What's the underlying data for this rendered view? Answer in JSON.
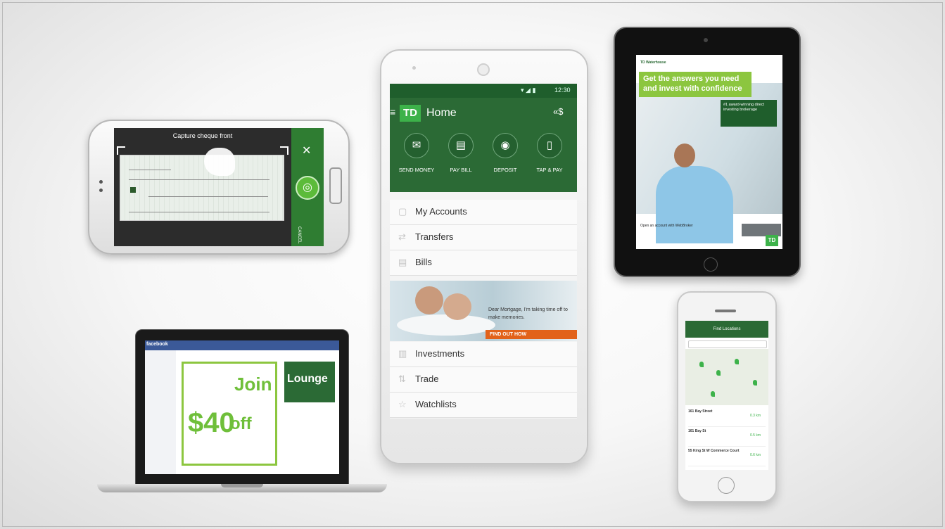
{
  "landscape_phone": {
    "capture_title": "Capture cheque front",
    "cancel_label": "CANCEL"
  },
  "center_phone": {
    "status_time": "12:30",
    "app_logo": "TD",
    "title": "Home",
    "actions": [
      {
        "label": "SEND MONEY",
        "icon": "send-money-icon",
        "glyph": "✉"
      },
      {
        "label": "PAY BILL",
        "icon": "pay-bill-icon",
        "glyph": "▤"
      },
      {
        "label": "DEPOSIT",
        "icon": "camera-icon",
        "glyph": "◉"
      },
      {
        "label": "TAP & PAY",
        "icon": "tap-pay-icon",
        "glyph": "▯"
      }
    ],
    "menu_top": [
      {
        "label": "My Accounts",
        "icon": "accounts-icon",
        "glyph": "▢"
      },
      {
        "label": "Transfers",
        "icon": "transfer-icon",
        "glyph": "⇄"
      },
      {
        "label": "Bills",
        "icon": "bills-icon",
        "glyph": "▤"
      }
    ],
    "banner": {
      "text": "Dear Mortgage, I'm taking time off to make memories.",
      "cta": "FIND OUT HOW"
    },
    "menu_bottom": [
      {
        "label": "Investments",
        "icon": "investments-icon",
        "glyph": "▥"
      },
      {
        "label": "Trade",
        "icon": "trade-icon",
        "glyph": "⇅"
      },
      {
        "label": "Watchlists",
        "icon": "star-icon",
        "glyph": "☆"
      }
    ]
  },
  "tablet": {
    "brand": "TD Waterhouse",
    "headline": "Get the answers you need and invest with confidence",
    "badge": "#1 award-winning direct investing brokerage",
    "footer": "Open an account with WebBroker",
    "logo": "TD"
  },
  "iphone": {
    "title": "Find Locations",
    "rows": [
      {
        "name": "161 Bay Street",
        "dist": "0.3 km"
      },
      {
        "name": "161 Bay St",
        "dist": "0.5 km"
      },
      {
        "name": "55 King St W Commerce Court",
        "dist": "0.6 km"
      }
    ]
  },
  "laptop": {
    "fb_logo": "facebook",
    "join": "Join",
    "forty": "$40",
    "off": "off",
    "lounge": "Lounge"
  },
  "colors": {
    "td_green": "#2b6a35",
    "td_light_green": "#3db24a",
    "accent_orange": "#e2621a",
    "fb_blue": "#3b5998"
  }
}
